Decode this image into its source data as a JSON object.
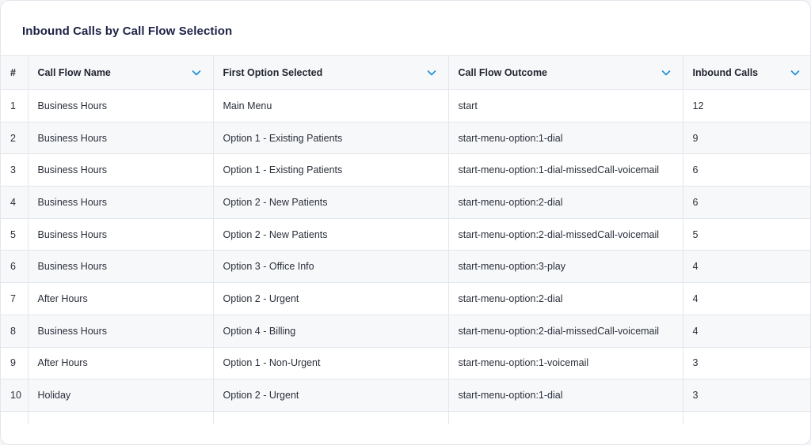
{
  "title": "Inbound Calls by Call Flow Selection",
  "colors": {
    "title": "#1c2246",
    "chevron": "#1a8fd6",
    "header_bg": "#f7f8fa",
    "stripe_bg": "#f7f8fa",
    "border": "#e3e6eb"
  },
  "table": {
    "headers": {
      "index": "#",
      "call_flow_name": "Call Flow Name",
      "first_option": "First Option Selected",
      "outcome": "Call Flow Outcome",
      "inbound_calls": "Inbound Calls"
    },
    "sort_icon": "chevron-down-icon",
    "rows": [
      {
        "n": "1",
        "name": "Business Hours",
        "option": "Main Menu",
        "outcome": "start",
        "calls": "12"
      },
      {
        "n": "2",
        "name": "Business Hours",
        "option": "Option 1 - Existing Patients",
        "outcome": "start-menu-option:1-dial",
        "calls": "9"
      },
      {
        "n": "3",
        "name": "Business Hours",
        "option": "Option 1 - Existing Patients",
        "outcome": "start-menu-option:1-dial-missedCall-voicemail",
        "calls": "6"
      },
      {
        "n": "4",
        "name": "Business Hours",
        "option": "Option 2 - New Patients",
        "outcome": "start-menu-option:2-dial",
        "calls": "6"
      },
      {
        "n": "5",
        "name": "Business Hours",
        "option": "Option 2 - New Patients",
        "outcome": "start-menu-option:2-dial-missedCall-voicemail",
        "calls": "5"
      },
      {
        "n": "6",
        "name": "Business Hours",
        "option": "Option 3 - Office Info",
        "outcome": "start-menu-option:3-play",
        "calls": "4"
      },
      {
        "n": "7",
        "name": "After Hours",
        "option": "Option 2 - Urgent",
        "outcome": "start-menu-option:2-dial",
        "calls": "4"
      },
      {
        "n": "8",
        "name": "Business Hours",
        "option": "Option 4 - Billing",
        "outcome": "start-menu-option:2-dial-missedCall-voicemail",
        "calls": "4"
      },
      {
        "n": "9",
        "name": "After Hours",
        "option": "Option 1 - Non-Urgent",
        "outcome": "start-menu-option:1-voicemail",
        "calls": "3"
      },
      {
        "n": "10",
        "name": "Holiday",
        "option": "Option 2 - Urgent",
        "outcome": "start-menu-option:1-dial",
        "calls": "3"
      }
    ]
  }
}
